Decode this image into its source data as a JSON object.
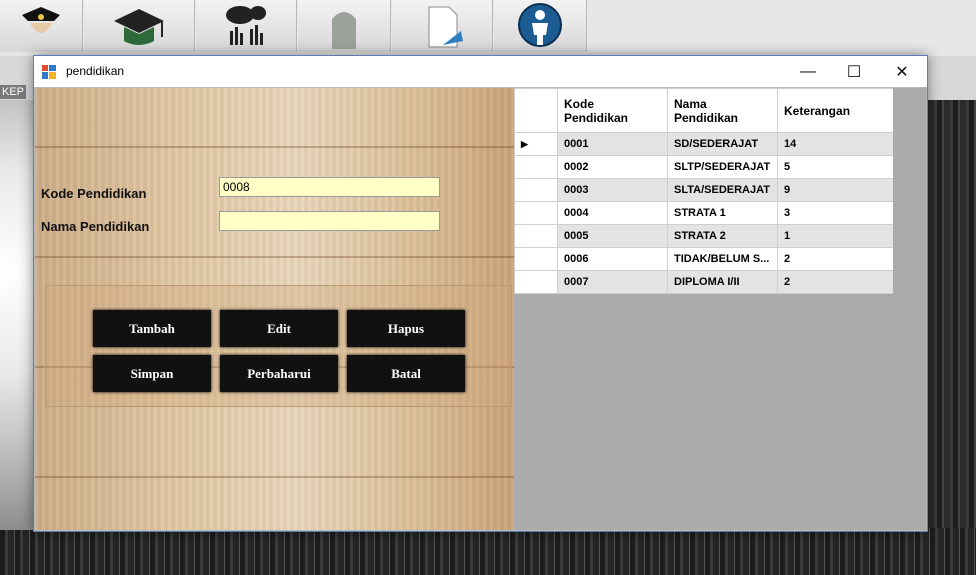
{
  "window": {
    "title": "pendidikan",
    "minimize": "—",
    "maximize": "☐",
    "close": "✕"
  },
  "background": {
    "side_label": "KEP",
    "toolbar_icons": [
      "officer-icon",
      "graduation-cap-icon",
      "chart-icon",
      "gravestone-icon",
      "document-icon",
      "person-icon"
    ]
  },
  "form": {
    "kode_label": "Kode Pendidikan",
    "kode_value": "0008",
    "nama_label": "Nama Pendidikan",
    "nama_value": ""
  },
  "buttons": {
    "tambah": "Tambah",
    "edit": "Edit",
    "hapus": "Hapus",
    "simpan": "Simpan",
    "perbaharui": "Perbaharui",
    "batal": "Batal"
  },
  "grid": {
    "headers": [
      "Kode Pendidikan",
      "Nama Pendidikan",
      "Keterangan"
    ],
    "current_row_marker": "▶",
    "rows": [
      {
        "kode": "0001",
        "nama": "SD/SEDERAJAT",
        "ket": "14"
      },
      {
        "kode": "0002",
        "nama": "SLTP/SEDERAJAT",
        "ket": "5"
      },
      {
        "kode": "0003",
        "nama": "SLTA/SEDERAJAT",
        "ket": "9"
      },
      {
        "kode": "0004",
        "nama": "STRATA 1",
        "ket": "3"
      },
      {
        "kode": "0005",
        "nama": "STRATA 2",
        "ket": "1"
      },
      {
        "kode": "0006",
        "nama": "TIDAK/BELUM S...",
        "ket": "2"
      },
      {
        "kode": "0007",
        "nama": "DIPLOMA I/II",
        "ket": "2"
      }
    ]
  },
  "colors": {
    "input_bg": "#ffffc6",
    "button_bg": "#111111",
    "grid_alt_row": "#e3e3e3"
  }
}
